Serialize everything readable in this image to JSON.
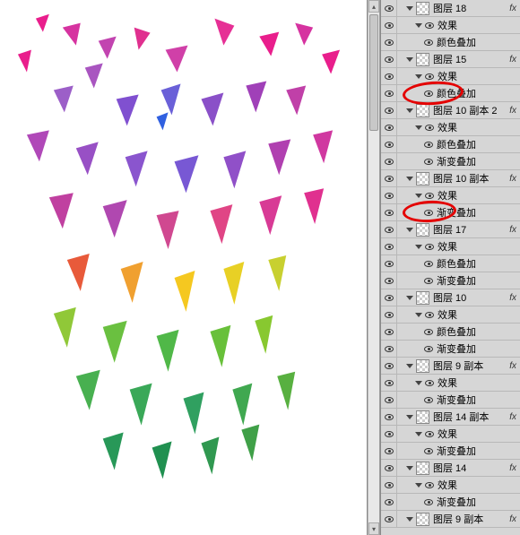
{
  "labels": {
    "effect": "效果",
    "colorOverlay": "颜色叠加",
    "gradientOverlay": "渐变叠加",
    "fx": "fx"
  },
  "layers": [
    {
      "type": "layer",
      "name": "图层 18",
      "indent": 1,
      "fx": true
    },
    {
      "type": "effect",
      "indent": 2
    },
    {
      "type": "sub",
      "kind": "colorOverlay",
      "indent": 3
    },
    {
      "type": "layer",
      "name": "图层 15",
      "indent": 1,
      "fx": true
    },
    {
      "type": "effect",
      "indent": 2
    },
    {
      "type": "sub",
      "kind": "colorOverlay",
      "indent": 3,
      "circled": 1
    },
    {
      "type": "layer",
      "name": "图层 10 副本 2",
      "indent": 1,
      "fx": true
    },
    {
      "type": "effect",
      "indent": 2
    },
    {
      "type": "sub",
      "kind": "colorOverlay",
      "indent": 3
    },
    {
      "type": "sub",
      "kind": "gradientOverlay",
      "indent": 3
    },
    {
      "type": "layer",
      "name": "图层 10 副本",
      "indent": 1,
      "fx": true
    },
    {
      "type": "effect",
      "indent": 2
    },
    {
      "type": "sub",
      "kind": "gradientOverlay",
      "indent": 3,
      "circled": 2
    },
    {
      "type": "layer",
      "name": "图层 17",
      "indent": 1,
      "fx": true
    },
    {
      "type": "effect",
      "indent": 2
    },
    {
      "type": "sub",
      "kind": "colorOverlay",
      "indent": 3
    },
    {
      "type": "sub",
      "kind": "gradientOverlay",
      "indent": 3
    },
    {
      "type": "layer",
      "name": "图层 10",
      "indent": 1,
      "fx": true
    },
    {
      "type": "effect",
      "indent": 2
    },
    {
      "type": "sub",
      "kind": "colorOverlay",
      "indent": 3
    },
    {
      "type": "sub",
      "kind": "gradientOverlay",
      "indent": 3
    },
    {
      "type": "layer",
      "name": "图层 9 副本",
      "indent": 1,
      "fx": true
    },
    {
      "type": "effect",
      "indent": 2
    },
    {
      "type": "sub",
      "kind": "gradientOverlay",
      "indent": 3
    },
    {
      "type": "layer",
      "name": "图层 14 副本",
      "indent": 1,
      "fx": true
    },
    {
      "type": "effect",
      "indent": 2
    },
    {
      "type": "sub",
      "kind": "gradientOverlay",
      "indent": 3
    },
    {
      "type": "layer",
      "name": "图层 14",
      "indent": 1,
      "fx": true
    },
    {
      "type": "effect",
      "indent": 2
    },
    {
      "type": "sub",
      "kind": "gradientOverlay",
      "indent": 3
    },
    {
      "type": "layer",
      "name": "图层 9 副本",
      "indent": 1,
      "fx": true
    }
  ]
}
